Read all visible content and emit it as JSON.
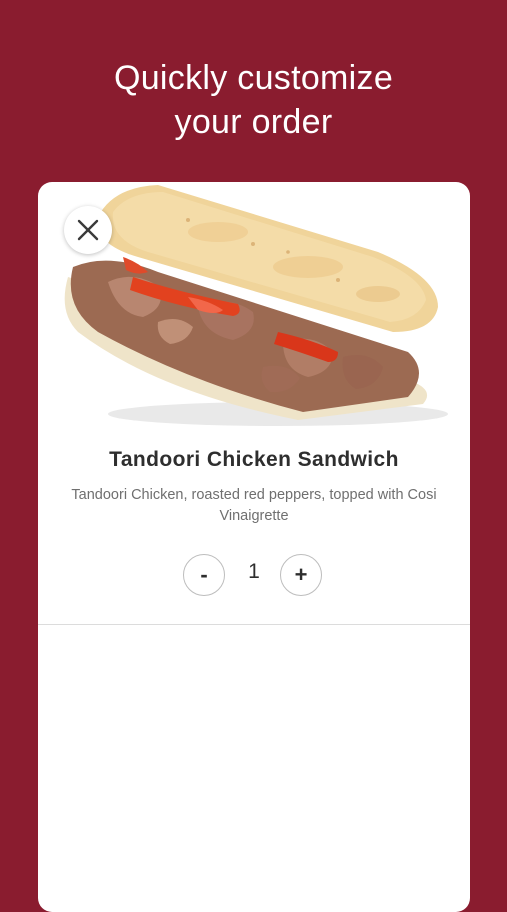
{
  "headline": {
    "line1": "Quickly customize",
    "line2": "your order"
  },
  "item": {
    "name": "Tandoori Chicken Sandwich",
    "description": "Tandoori Chicken, roasted red peppers, topped with Cosi Vinaigrette"
  },
  "quantity": {
    "minus_label": "-",
    "value": "1",
    "plus_label": "+"
  },
  "colors": {
    "background": "#8a1c2f",
    "card": "#ffffff",
    "title_text": "#2e2e2e",
    "desc_text": "#6f6f6f"
  },
  "icons": {
    "close": "close-icon"
  }
}
